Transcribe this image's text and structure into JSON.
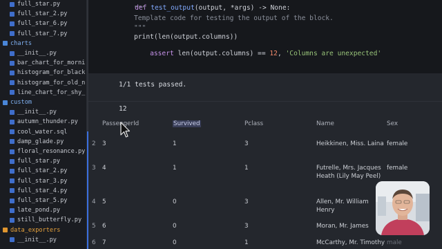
{
  "sidebar": {
    "rows": [
      {
        "type": "file",
        "label": "full_star.py",
        "indent": 1
      },
      {
        "type": "file",
        "label": "full_star_2.py",
        "indent": 1
      },
      {
        "type": "file",
        "label": "full_star_6.py",
        "indent": 1
      },
      {
        "type": "file",
        "label": "full_star_7.py",
        "indent": 1
      },
      {
        "type": "folder",
        "label": "charts",
        "color": "blue",
        "indent": 0
      },
      {
        "type": "file",
        "label": "__init__.py",
        "indent": 1
      },
      {
        "type": "file",
        "label": "bar_chart_for_morni",
        "indent": 1
      },
      {
        "type": "file",
        "label": "histogram_for_black",
        "indent": 1
      },
      {
        "type": "file",
        "label": "histogram_for_old_n",
        "indent": 1
      },
      {
        "type": "file",
        "label": "line_chart_for_shy_",
        "indent": 1
      },
      {
        "type": "folder",
        "label": "custom",
        "color": "blue",
        "indent": 0
      },
      {
        "type": "file",
        "label": "__init__.py",
        "indent": 1
      },
      {
        "type": "file",
        "label": "autumn_thunder.py",
        "indent": 1
      },
      {
        "type": "file",
        "label": "cool_water.sql",
        "indent": 1
      },
      {
        "type": "file",
        "label": "damp_glade.py",
        "indent": 1
      },
      {
        "type": "file",
        "label": "floral_resonance.py",
        "indent": 1
      },
      {
        "type": "file",
        "label": "full_star.py",
        "indent": 1
      },
      {
        "type": "file",
        "label": "full_star_2.py",
        "indent": 1
      },
      {
        "type": "file",
        "label": "full_star_3.py",
        "indent": 1
      },
      {
        "type": "file",
        "label": "full_star_4.py",
        "indent": 1
      },
      {
        "type": "file",
        "label": "full_star_5.py",
        "indent": 1
      },
      {
        "type": "file",
        "label": "late_pond.py",
        "indent": 1
      },
      {
        "type": "file",
        "label": "still_butterfly.py",
        "indent": 1
      },
      {
        "type": "folder",
        "label": "data_exporters",
        "color": "orange",
        "indent": 0
      },
      {
        "type": "file",
        "label": "__init__.py",
        "indent": 1
      }
    ]
  },
  "code": {
    "line0": {
      "kw": "def",
      "fn": "test_output",
      "rest": "(output, *args) -> None:"
    },
    "line1": "\"\"\"",
    "line2": "Template code for testing the output of the block.",
    "line3": "\"\"\"",
    "line4": "print(len(output.columns))",
    "line5": {
      "kw": "assert",
      "pre": " len(output.columns) == ",
      "num": "12",
      "mid": ", ",
      "str": "'Columns are unexpected'"
    }
  },
  "output": {
    "tests_passed": "1/1 tests passed.",
    "row_count": "12",
    "columns": [
      "PassengerId",
      "Survived",
      "Pclass",
      "Name",
      "Sex"
    ],
    "highlighted_column": "Survived",
    "rows": [
      {
        "index": "2",
        "PassengerId": "3",
        "Survived": "1",
        "Pclass": "3",
        "Name": [
          "Heikkinen, Miss. Laina"
        ],
        "Sex": "female"
      },
      {
        "index": "3",
        "PassengerId": "4",
        "Survived": "1",
        "Pclass": "1",
        "Name": [
          "Futrelle, Mrs. Jacques",
          "Heath (Lily May Peel)"
        ],
        "Sex": "female"
      },
      {
        "index": "4",
        "PassengerId": "5",
        "Survived": "0",
        "Pclass": "3",
        "Name": [
          "Allen, Mr. William",
          "Henry"
        ],
        "Sex": "male"
      },
      {
        "index": "5",
        "PassengerId": "6",
        "Survived": "0",
        "Pclass": "3",
        "Name": [
          "Moran, Mr. James"
        ],
        "Sex": "male"
      },
      {
        "index": "6",
        "PassengerId": "7",
        "Survived": "0",
        "Pclass": "1",
        "Name": [
          "McCarthy, Mr. Timothy"
        ],
        "Sex": "male"
      }
    ]
  },
  "colors": {
    "accent_blue": "#3b6fe0",
    "folder_orange": "#e8a33c",
    "header_highlight": "#3a3f59"
  }
}
